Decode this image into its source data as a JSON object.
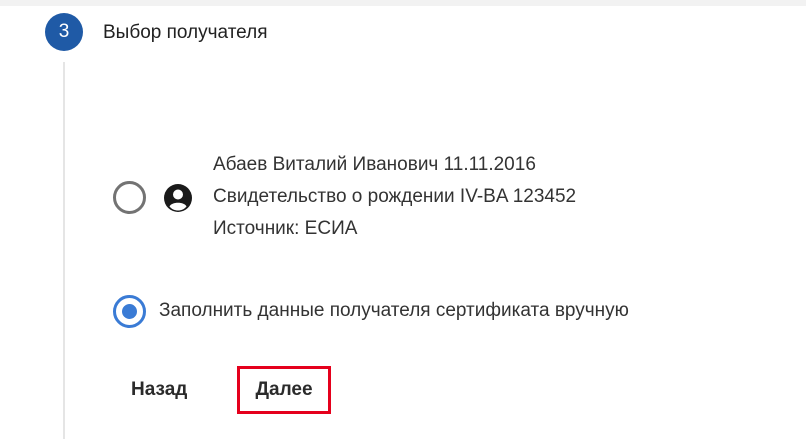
{
  "step": {
    "number": "3",
    "title": "Выбор получателя"
  },
  "recipient_option": {
    "line1": "Абаев Виталий Иванович 11.11.2016",
    "line2": "Свидетельство о рождении IV-BA 123452",
    "line3": "Источник: ЕСИА",
    "selected": false,
    "icon": "account-circle-icon"
  },
  "manual_option": {
    "label": "Заполнить данные получателя сертификата вручную",
    "selected": true
  },
  "buttons": {
    "back_label": "Назад",
    "next_label": "Далее"
  },
  "colors": {
    "step_circle": "#1f5aa6",
    "radio_selected": "#3a7bd5",
    "highlight_border": "#e5001c"
  }
}
